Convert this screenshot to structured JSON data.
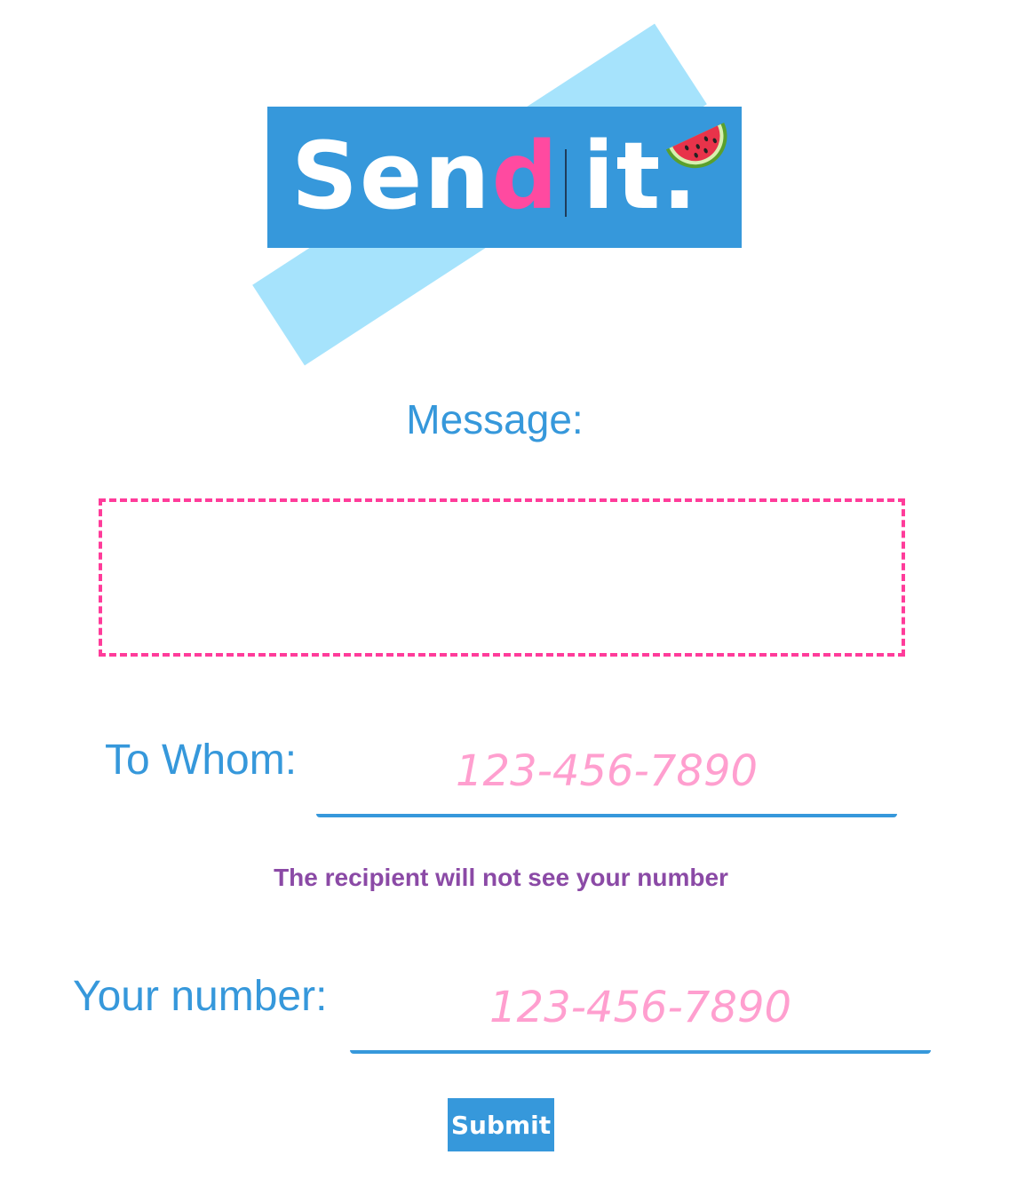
{
  "logo": {
    "text_before": "Sen",
    "text_accent": "d",
    "text_after": "it.",
    "icon": "watermelon-icon",
    "colors": {
      "box": "#3698db",
      "stripe": "#a6e3fc",
      "accent": "#ff4aa0"
    }
  },
  "form": {
    "message_label": "Message:",
    "message_value": "",
    "to_label": "To Whom:",
    "to_placeholder": "123-456-7890",
    "note": "The recipient will not see your number",
    "from_label": "Your number:",
    "from_placeholder": "123-456-7890",
    "submit_label": "Submit"
  },
  "colors": {
    "primary": "#3698db",
    "pink": "#ff3c9a",
    "placeholder_pink": "#ff9fcf",
    "note_purple": "#8b4aa6"
  }
}
